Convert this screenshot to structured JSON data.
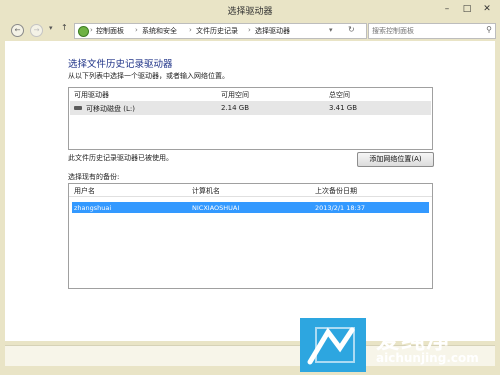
{
  "window": {
    "title": "选择驱动器"
  },
  "nav": {
    "breadcrumbs": [
      "控制面板",
      "系统和安全",
      "文件历史记录",
      "选择驱动器"
    ],
    "search_placeholder": "搜索控制面板"
  },
  "main": {
    "heading": "选择文件历史记录驱动器",
    "subtext": "从以下列表中选择一个驱动器，或者输入网络位置。",
    "drives": {
      "columns": [
        "可用驱动器",
        "可用空间",
        "总空间"
      ],
      "rows": [
        {
          "name": "可移动磁盘 (L:)",
          "free": "2.14 GB",
          "total": "3.41 GB"
        }
      ]
    },
    "status": "此文件历史记录驱动器已被使用。",
    "add_network_button": "添加网络位置(A)",
    "backups_label": "选择现有的备份:",
    "backups": {
      "columns": [
        "用户名",
        "计算机名",
        "上次备份日期"
      ],
      "rows": [
        {
          "user": "zhangshuai",
          "computer": "NICXIAOSHUAI",
          "date": "2013/2/1 18:37"
        }
      ]
    }
  },
  "watermark": {
    "cn": "爱纯净",
    "url": "aichunjing.com"
  },
  "colors": {
    "accent": "#1e3287",
    "selection": "#3399ff",
    "frame": "#e9e4c6"
  }
}
